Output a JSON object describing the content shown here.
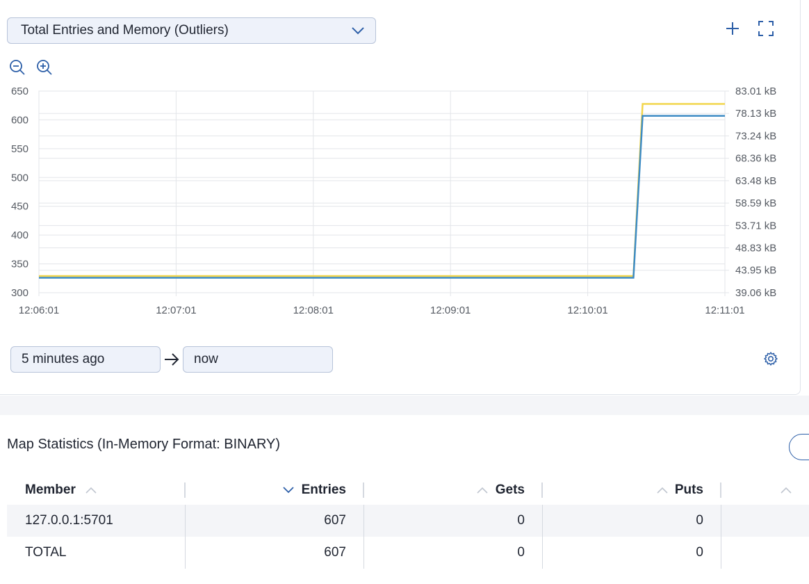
{
  "chart_selector": {
    "selected": "Total Entries and Memory (Outliers)"
  },
  "toolbar": {
    "add_icon": "plus-icon",
    "fullscreen_icon": "expand-icon",
    "zoom_out_icon": "zoom-out-icon",
    "zoom_in_icon": "zoom-in-icon"
  },
  "range": {
    "from": "5 minutes ago",
    "to": "now",
    "arrow_icon": "arrow-right-icon",
    "settings_icon": "gear-icon"
  },
  "chart_data": {
    "type": "line",
    "x_ticks": [
      "12:06:01",
      "12:07:01",
      "12:08:01",
      "12:09:01",
      "12:10:01",
      "12:11:01"
    ],
    "y_left_ticks": [
      "650",
      "600",
      "550",
      "500",
      "450",
      "400",
      "350",
      "300"
    ],
    "y_left_lim": [
      300,
      650
    ],
    "y_right_ticks": [
      "83.01 kB",
      "78.13 kB",
      "73.24 kB",
      "68.36 kB",
      "63.48 kB",
      "58.59 kB",
      "53.71 kB",
      "48.83 kB",
      "43.95 kB",
      "39.06 kB"
    ],
    "y_right_lim_kb": [
      39.06,
      83.01
    ],
    "grid": true,
    "series": [
      {
        "axis": "left",
        "color": "#3d8bc4",
        "x": [
          "12:06:01",
          "12:10:21",
          "12:10:25",
          "12:11:01"
        ],
        "y": [
          326,
          326,
          607,
          607
        ]
      },
      {
        "axis": "right",
        "color": "#f2d54b",
        "x": [
          "12:06:01",
          "12:10:21",
          "12:10:25",
          "12:11:01"
        ],
        "y_kb": [
          42.7,
          42.7,
          80.2,
          80.2
        ]
      }
    ]
  },
  "stats": {
    "title": "Map Statistics (In-Memory Format: BINARY)",
    "headers": {
      "member": "Member",
      "entries": "Entries",
      "gets": "Gets",
      "puts": "Puts"
    },
    "rows": [
      {
        "member": "127.0.0.1:5701",
        "entries": "607",
        "gets": "0",
        "puts": "0"
      },
      {
        "member": "TOTAL",
        "entries": "607",
        "gets": "0",
        "puts": "0"
      }
    ]
  }
}
